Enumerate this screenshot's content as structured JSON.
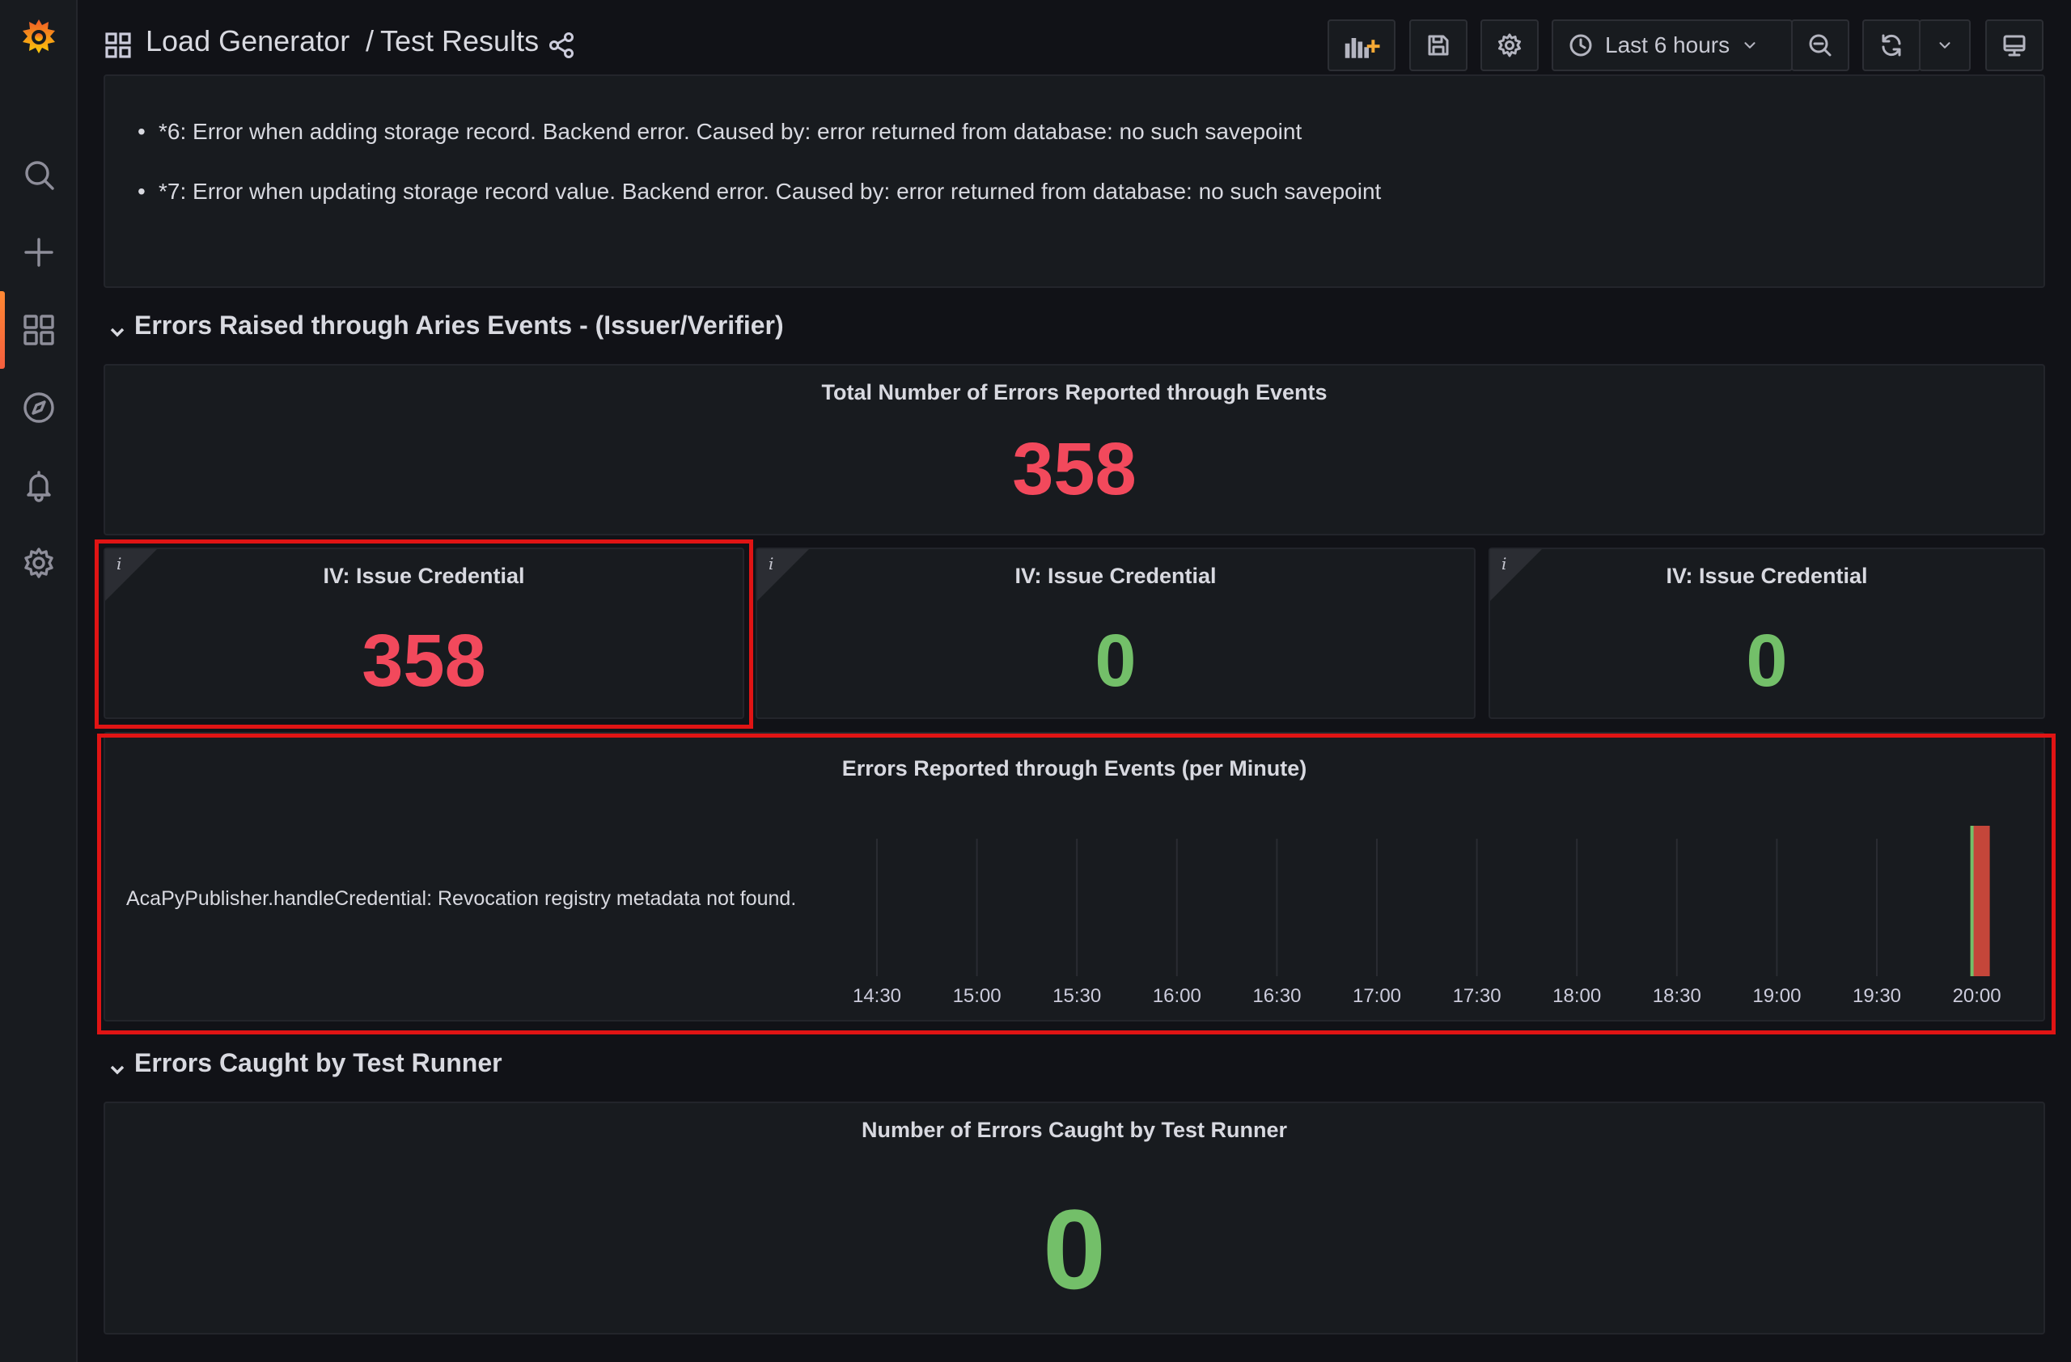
{
  "header": {
    "folder": "Load Generator",
    "separator": "/",
    "title": "Test Results",
    "time_range": "Last 6 hours"
  },
  "notes": [
    "*6: Error when adding storage record. Backend error. Caused by: error returned from database: no such savepoint",
    "*7: Error when updating storage record value. Backend error. Caused by: error returned from database: no such savepoint"
  ],
  "rows": [
    {
      "title": "Errors Raised through Aries Events - (Issuer/Verifier)"
    },
    {
      "title": "Errors Caught by Test Runner"
    }
  ],
  "panels": {
    "total_events": {
      "title": "Total Number of Errors Reported through Events",
      "value": "358"
    },
    "iv1": {
      "title": "IV: Issue Credential",
      "value": "358"
    },
    "iv2": {
      "title": "IV: Issue Credential",
      "value": "0"
    },
    "iv3": {
      "title": "IV: Issue Credential",
      "value": "0"
    },
    "per_minute": {
      "title": "Errors Reported through Events (per Minute)"
    },
    "test_runner": {
      "title": "Number of Errors Caught by Test Runner",
      "value": "0"
    }
  },
  "colors": {
    "red": "#f2495c",
    "green": "#73bf69",
    "highlight": "#e01414"
  },
  "icons": [
    "grafana-logo-icon",
    "search-icon",
    "plus-icon",
    "dashboards-icon",
    "explore-icon",
    "alert-bell-icon",
    "gear-icon"
  ],
  "chart_data": {
    "type": "bar",
    "title": "Errors Reported through Events (per Minute)",
    "series": [
      {
        "name": "AcaPyPublisher.handleCredential: Revocation registry metadata not found.",
        "x": [
          "20:00"
        ],
        "values": [
          1
        ]
      }
    ],
    "x_ticks": [
      "14:30",
      "15:00",
      "15:30",
      "16:00",
      "16:30",
      "17:00",
      "17:30",
      "18:00",
      "18:30",
      "19:00",
      "19:30",
      "20:00"
    ],
    "legend_placement": "left",
    "grid": true
  }
}
